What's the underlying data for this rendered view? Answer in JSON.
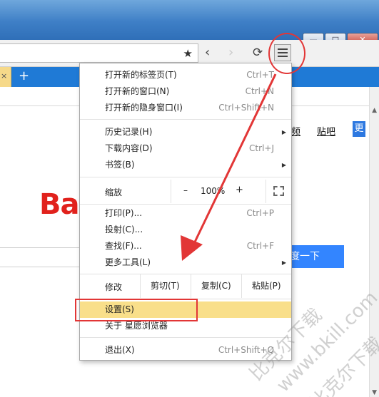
{
  "window": {
    "minimize_label": "—",
    "maximize_label": "□",
    "close_label": "✕"
  },
  "toolbar": {
    "star_icon": "★",
    "back_icon": "‹",
    "forward_icon": "›",
    "reload_icon": "⟳"
  },
  "tabs": {
    "close_label": "×",
    "new_tab_label": "+"
  },
  "page": {
    "nav_links": [
      "频",
      "贴吧"
    ],
    "nav_more": "更",
    "logo_text": "Ba",
    "search_button": "度一下"
  },
  "menu": {
    "items_group1": [
      {
        "label": "打开新的标签页(T)",
        "shortcut": "Ctrl+T"
      },
      {
        "label": "打开新的窗口(N)",
        "shortcut": "Ctrl+N"
      },
      {
        "label": "打开新的隐身窗口(I)",
        "shortcut": "Ctrl+Shift+N"
      }
    ],
    "items_group2": [
      {
        "label": "历史记录(H)",
        "shortcut": "",
        "arrow": "▶"
      },
      {
        "label": "下载内容(D)",
        "shortcut": "Ctrl+J",
        "arrow": ""
      },
      {
        "label": "书签(B)",
        "shortcut": "",
        "arrow": "▶"
      }
    ],
    "zoom": {
      "label": "缩放",
      "minus": "–",
      "value": "100%",
      "plus": "+"
    },
    "items_group3": [
      {
        "label": "打印(P)...",
        "shortcut": "Ctrl+P",
        "arrow": ""
      },
      {
        "label": "投射(C)...",
        "shortcut": "",
        "arrow": ""
      },
      {
        "label": "查找(F)...",
        "shortcut": "Ctrl+F",
        "arrow": ""
      },
      {
        "label": "更多工具(L)",
        "shortcut": "",
        "arrow": "▶"
      }
    ],
    "edit": {
      "label": "修改",
      "cut": "剪切(T)",
      "copy": "复制(C)",
      "paste": "粘贴(P)"
    },
    "settings": {
      "label": "设置(S)"
    },
    "about": {
      "label": "关于 星愿浏览器"
    },
    "exit": {
      "label": "退出(X)",
      "shortcut": "Ctrl+Shift+Q"
    }
  },
  "watermark": {
    "line1": "比克尔下载",
    "line2": "www.bkill.com",
    "line3": "比克尔下载"
  },
  "colors": {
    "accent_blue": "#1f7ad6",
    "highlight": "#f9df8a",
    "annotation_red": "#e23636",
    "logo_red": "#e1211c"
  }
}
